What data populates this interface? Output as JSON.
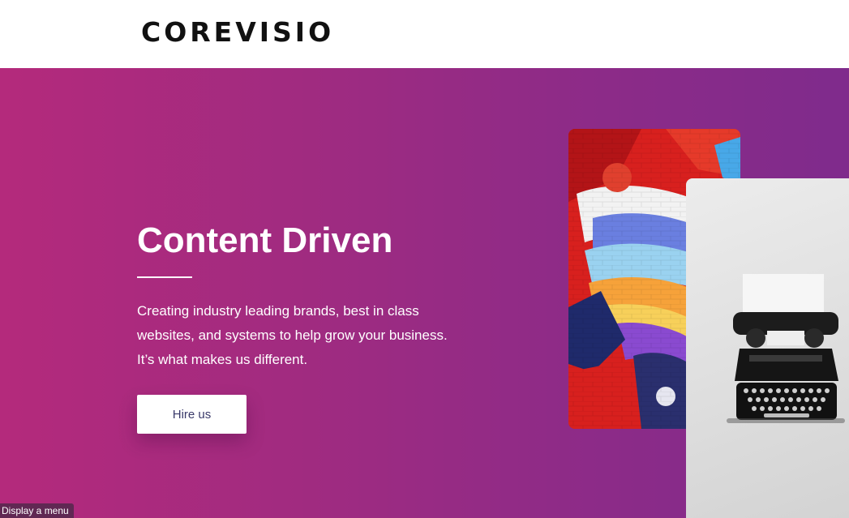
{
  "header": {
    "logo_text": "COREVISIO"
  },
  "hero": {
    "title": "Content Driven",
    "description_lines": [
      "Creating industry leading brands, best in class",
      "websites, and systems to help grow your business.",
      "It’s what makes us different."
    ],
    "cta_label": "Hire us"
  },
  "images": {
    "mural": "graffiti-mural-image",
    "typewriter": "typewriter-image"
  },
  "menu_hint": "Display a menu",
  "colors": {
    "gradient_start": "#b42a7c",
    "gradient_end": "#7f2b8c",
    "cta_text": "#3a3a6a",
    "header_bg": "#ffffff"
  }
}
